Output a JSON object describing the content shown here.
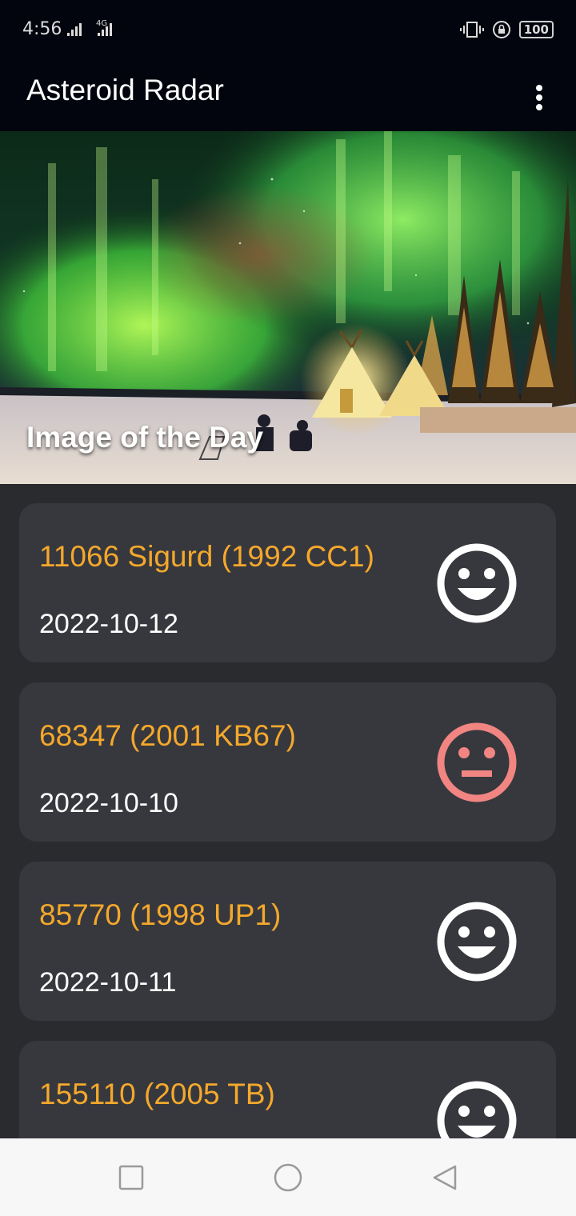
{
  "status_bar": {
    "time": "4:56",
    "network_label": "4G",
    "battery": "100"
  },
  "app_bar": {
    "title": "Asteroid Radar",
    "menu_icon": "more-vert-icon"
  },
  "hero": {
    "caption": "Image of the Day"
  },
  "asteroids": [
    {
      "name": "11066 Sigurd (1992 CC1)",
      "date": "2022-10-12",
      "status_icon": "happy-face-icon",
      "hazardous": false
    },
    {
      "name": "68347 (2001 KB67)",
      "date": "2022-10-10",
      "status_icon": "neutral-face-icon",
      "hazardous": true
    },
    {
      "name": "85770 (1998 UP1)",
      "date": "2022-10-11",
      "status_icon": "happy-face-icon",
      "hazardous": false
    },
    {
      "name": "155110 (2005 TB)",
      "date": "",
      "status_icon": "happy-face-icon",
      "hazardous": false
    }
  ],
  "colors": {
    "accent": "#f4a82c",
    "hazard": "#f08582",
    "safe": "#ffffff",
    "card_bg": "#37383d",
    "page_bg": "#2a2b2f",
    "bar_bg": "#02050e"
  },
  "nav_bar": {
    "buttons": [
      "recents-icon",
      "home-icon",
      "back-icon"
    ]
  }
}
